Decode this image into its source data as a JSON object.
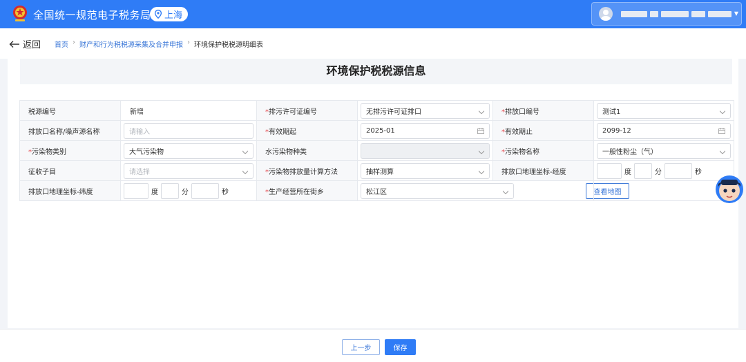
{
  "header": {
    "brand": "全国统一规范电子税务局",
    "region": "上海"
  },
  "breadcrumb": {
    "back_label": "返回",
    "items": [
      "首页",
      "财产和行为税税源采集及合并申报",
      "环境保护税税源明细表"
    ],
    "separator": "›"
  },
  "page": {
    "title": "环境保护税税源信息"
  },
  "form": {
    "source_no_label": "税源编号",
    "source_no_value": "新增",
    "permit_no_label": "排污许可证编号",
    "permit_no_value": "无排污许可证排口",
    "outlet_no_label": "排放口编号",
    "outlet_no_value": "测试1",
    "outlet_name_label": "排放口名称/噪声源名称",
    "outlet_name_placeholder": "请输入",
    "valid_from_label": "有效期起",
    "valid_from_value": "2025-01",
    "valid_to_label": "有效期止",
    "valid_to_value": "2099-12",
    "pollutant_type_label": "污染物类别",
    "pollutant_type_value": "大气污染物",
    "water_type_label": "水污染物种类",
    "pollutant_name_label": "污染物名称",
    "pollutant_name_value": "一般性粉尘（气）",
    "tax_item_label": "征收子目",
    "tax_item_placeholder": "请选择",
    "calc_method_label": "污染物排放量计算方法",
    "calc_method_value": "抽样测算",
    "longitude_label": "排放口地理坐标-经度",
    "latitude_label": "排放口地理坐标-纬度",
    "street_label": "生产经营所在街乡",
    "street_value": "松江区",
    "map_button": "查看地图",
    "unit_degree": "度",
    "unit_minute": "分",
    "unit_second": "秒",
    "required_mark": "*"
  },
  "footer": {
    "prev_label": "上一步",
    "save_label": "保存"
  },
  "icons": {
    "emblem": "national-emblem-icon",
    "region": "location-pin-icon",
    "back": "arrow-left-icon",
    "avatar": "user-avatar-icon",
    "assistant": "assistant-mascot-icon"
  },
  "colors": {
    "primary": "#2f7cf6",
    "required": "#e5484d"
  }
}
